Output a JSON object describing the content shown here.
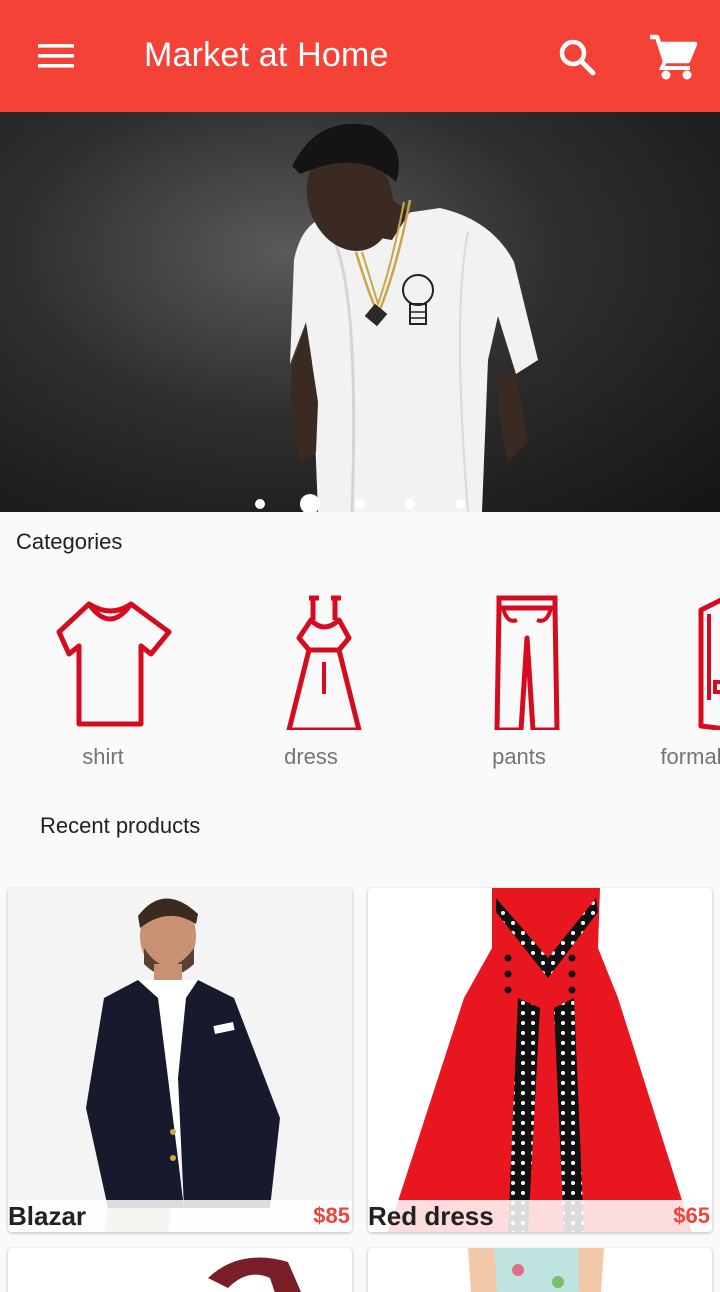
{
  "app": {
    "title": "Market at Home"
  },
  "header": {
    "menu_icon": "menu-icon",
    "search_icon": "search-icon",
    "cart_icon": "shopping-cart-icon"
  },
  "carousel": {
    "slide_count": 5,
    "active_index": 1,
    "current_image": "man in white t-shirt with gold chains"
  },
  "categories": {
    "title": "Categories",
    "items": [
      {
        "label": "shirt",
        "icon": "shirt-icon"
      },
      {
        "label": "dress",
        "icon": "dress-icon"
      },
      {
        "label": "pants",
        "icon": "pants-icon"
      },
      {
        "label": "formal",
        "icon": "blazer-icon"
      }
    ]
  },
  "recent": {
    "title": "Recent products",
    "products": [
      {
        "name": "Blazar",
        "price": "$85"
      },
      {
        "name": "Red dress",
        "price": "$65"
      }
    ]
  },
  "colors": {
    "primary": "#f44336",
    "icon_red": "#d50b1f"
  }
}
